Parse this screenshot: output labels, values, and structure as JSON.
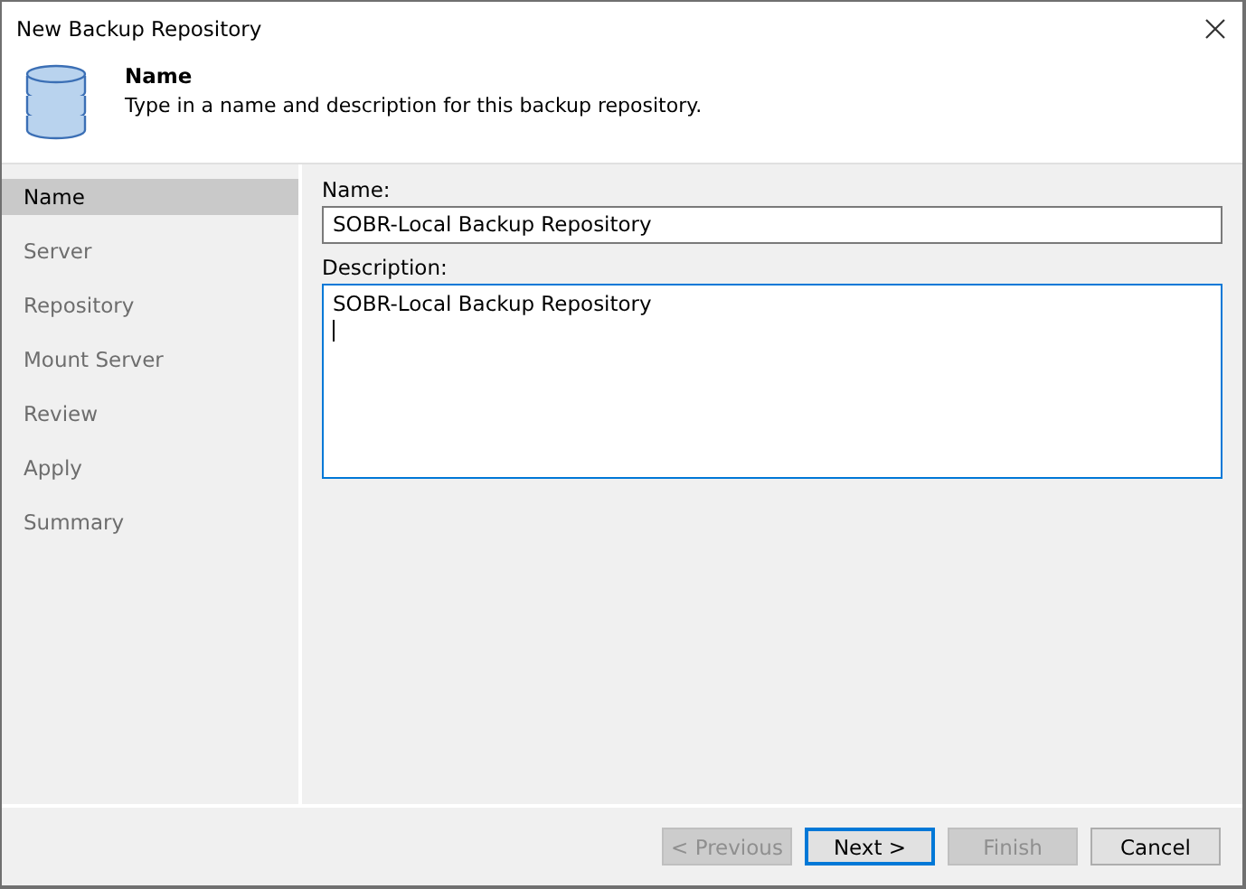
{
  "window": {
    "title": "New Backup Repository"
  },
  "header": {
    "title": "Name",
    "subtitle": "Type in a name and description for this backup repository."
  },
  "steps": [
    {
      "label": "Name",
      "selected": true
    },
    {
      "label": "Server",
      "selected": false
    },
    {
      "label": "Repository",
      "selected": false
    },
    {
      "label": "Mount Server",
      "selected": false
    },
    {
      "label": "Review",
      "selected": false
    },
    {
      "label": "Apply",
      "selected": false
    },
    {
      "label": "Summary",
      "selected": false
    }
  ],
  "name_field": {
    "label": "Name:",
    "value": "SOBR-Local Backup Repository"
  },
  "description_field": {
    "label": "Description:",
    "value": "SOBR-Local Backup Repository",
    "focused": true
  },
  "buttons": [
    {
      "label": "< Previous",
      "disabled": true,
      "default": false
    },
    {
      "label": "Next >",
      "disabled": false,
      "default": true
    },
    {
      "label": "Finish",
      "disabled": true,
      "default": false
    },
    {
      "label": "Cancel",
      "disabled": false,
      "default": false
    }
  ]
}
